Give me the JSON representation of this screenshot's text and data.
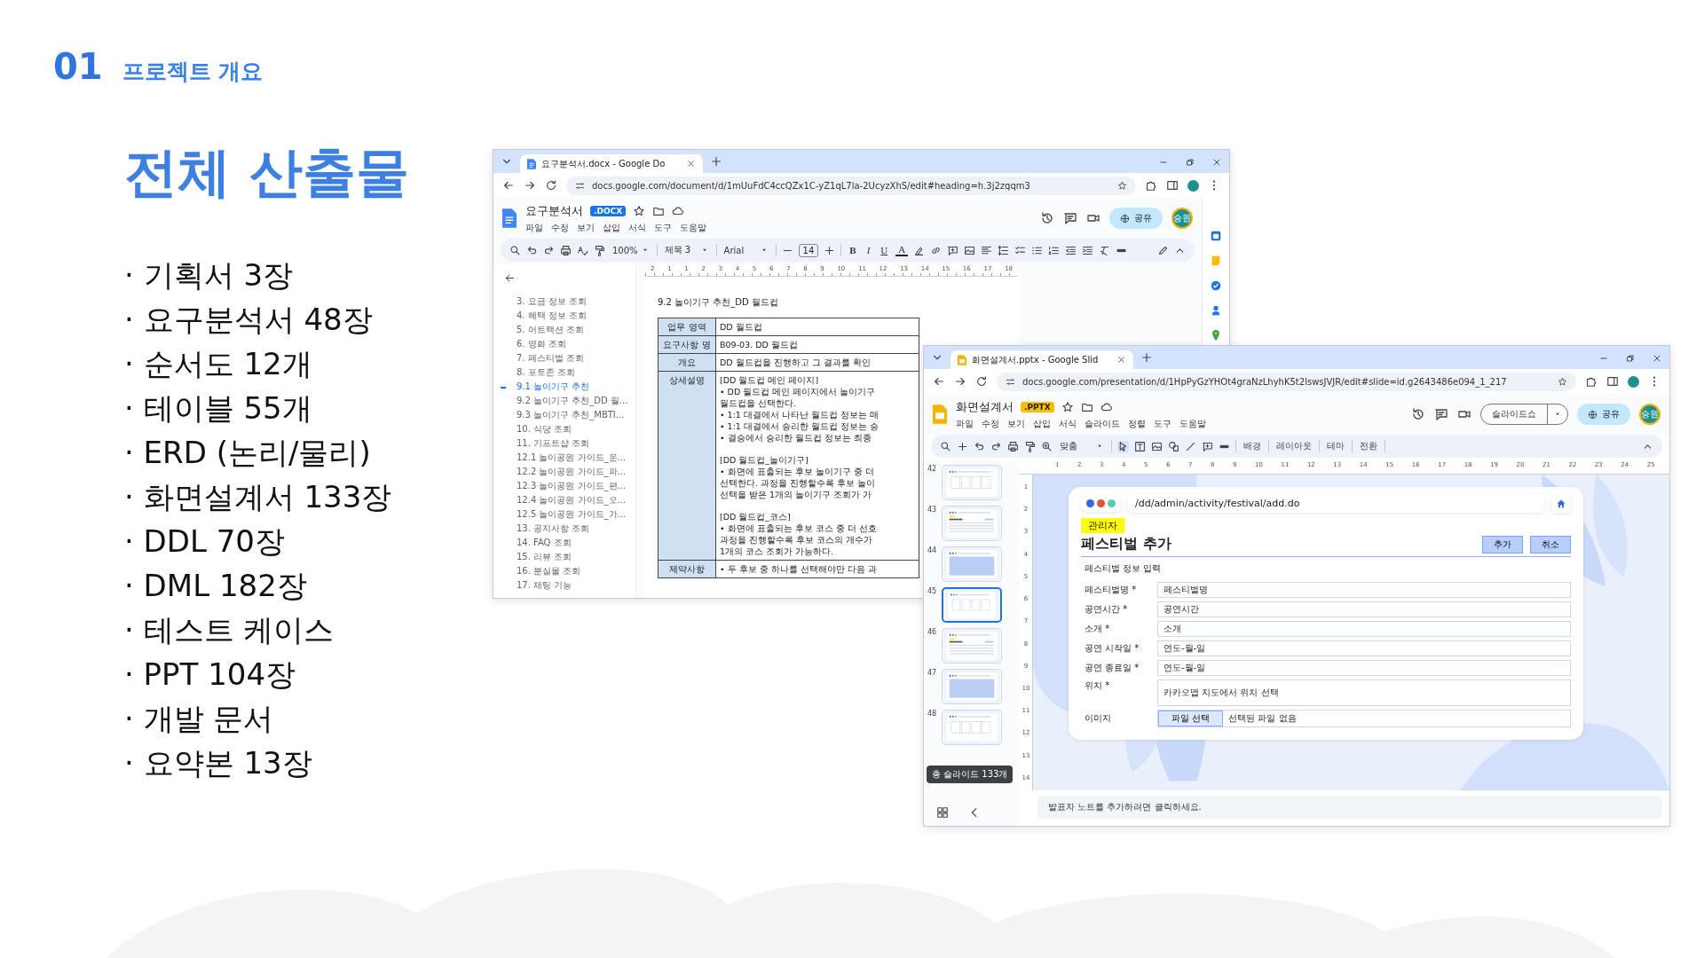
{
  "section": {
    "number": "01",
    "title": "프로젝트 개요"
  },
  "heading": "전체 산출물",
  "deliverables": [
    "· 기획서 3장",
    "· 요구분석서 48장",
    "· 순서도 12개",
    "· 테이블 55개",
    "· ERD (논리/물리)",
    "· 화면설계서 133장",
    "· DDL 70장",
    "· DML 182장",
    "· 테스트 케이스",
    "· PPT 104장",
    "· 개발 문서",
    "· 요약본 13장"
  ],
  "docs_window": {
    "tab_title": "요구분석서.docx - Google Do",
    "url": "docs.google.com/document/d/1mUuFdC4ccQZx1C-yZ1qL7la-2UcyzXhS/edit#heading=h.3j2zqqm3",
    "doc_title": "요구분석서",
    "badge": ".DOCX",
    "menu": [
      "파일",
      "수정",
      "보기",
      "삽입",
      "서식",
      "도구",
      "도움말"
    ],
    "share": "공유",
    "avatar": "승원",
    "toolbar": {
      "zoom": "100%",
      "style": "제목 3",
      "font": "Arial",
      "font_size": "14",
      "format": [
        "B",
        "I",
        "U",
        "A"
      ]
    },
    "ruler": [
      "2",
      "1",
      "1",
      "2",
      "3",
      "4",
      "5",
      "6",
      "7",
      "8",
      "9",
      "10",
      "11",
      "12",
      "13",
      "14",
      "15",
      "16",
      "17",
      "18"
    ],
    "outline": [
      {
        "text": "3. 요금 정보 조회",
        "selected": false
      },
      {
        "text": "4. 혜택 정보 조회",
        "selected": false
      },
      {
        "text": "5. 어트랙션 조회",
        "selected": false
      },
      {
        "text": "6. 영화 조회",
        "selected": false
      },
      {
        "text": "7. 페스티벌 조회",
        "selected": false
      },
      {
        "text": "8. 포토존 조회",
        "selected": false
      },
      {
        "text": "9.1 놀이기구 추천",
        "selected": true
      },
      {
        "text": "9.2 놀이기구 추천_DD 월...",
        "selected": false
      },
      {
        "text": "9.3 놀이기구 추천_MBTI...",
        "selected": false
      },
      {
        "text": "10. 식당 조회",
        "selected": false
      },
      {
        "text": "11. 기프트샵 조회",
        "selected": false
      },
      {
        "text": "12.1 놀이공원 가이드_운...",
        "selected": false
      },
      {
        "text": "12.2 놀이공원 가이드_파...",
        "selected": false
      },
      {
        "text": "12.3 놀이공원 가이드_편...",
        "selected": false
      },
      {
        "text": "12.4 놀이공원 가이드_오...",
        "selected": false
      },
      {
        "text": "12.5 놀이공원 가이드_가...",
        "selected": false
      },
      {
        "text": "13. 공지사항 조회",
        "selected": false
      },
      {
        "text": "14. FAQ 조회",
        "selected": false
      },
      {
        "text": "15. 리뷰 조회",
        "selected": false
      },
      {
        "text": "16. 분실물 조회",
        "selected": false
      },
      {
        "text": "17. 채팅 기능",
        "selected": false
      }
    ],
    "heading": "9.2 놀이기구 추천_DD 월드컵",
    "table": [
      {
        "label": "업무 영역",
        "paragraphs": [
          [
            "DD 월드컵"
          ]
        ]
      },
      {
        "label": "요구사항 명",
        "paragraphs": [
          [
            "B09-03. DD 월드컵"
          ]
        ]
      },
      {
        "label": "개요",
        "paragraphs": [
          [
            "DD 월드컵을 진행하고 그 결과를 확인"
          ]
        ]
      },
      {
        "label": "상세설명",
        "paragraphs": [
          [
            "[DD 월드컵 메인 페이지]",
            "• DD 월드컵 메인 페이지에서 놀이기구",
            "월드컵을 선택한다.",
            "• 1:1 대결에서 나타난 월드컵 정보는 매",
            "• 1:1 대결에서 승리한 월드컵 정보는 승",
            "• 결승에서 승리한 월드컵 정보는 최종"
          ],
          [
            "[DD 월드컵_놀이기구]",
            "• 화면에 표출되는 후보 놀이기구 중 더",
            "선택한다. 과정을 진행할수록 후보 놀이",
            "선택을 받은 1개의 놀이기구 조회가 가"
          ],
          [
            "[DD 월드컵_코스]",
            "• 화면에 표출되는 후보 코스 중 더 선호",
            "과정을 진행할수록 후보 코스의 개수가",
            "1개의 코스 조회가 가능하다."
          ]
        ]
      },
      {
        "label": "제약사항",
        "paragraphs": [
          [
            "• 두 후보 중 하나를 선택해야만 다음 과"
          ]
        ]
      }
    ]
  },
  "slides_window": {
    "tab_title": "화면설계서.pptx - Google Slid",
    "url": "docs.google.com/presentation/d/1HpPyGzYHOt4graNzLhyhK5t2lswsJVJR/edit#slide=id.g2643486e094_1_217",
    "title": "화면설계서",
    "badge": ".PPTX",
    "menu": [
      "파일",
      "수정",
      "보기",
      "삽입",
      "서식",
      "슬라이드",
      "정렬",
      "도구",
      "도움말"
    ],
    "slideshow": "슬라이드쇼",
    "share": "공유",
    "avatar": "승원",
    "toolbar": {
      "zoom": "맞춤",
      "tabs": [
        "배경",
        "레이아웃",
        "테마",
        "전환"
      ]
    },
    "ruler_h": [
      "1",
      "2",
      "3",
      "4",
      "5",
      "6",
      "7",
      "8",
      "9",
      "10",
      "11",
      "12",
      "13",
      "14",
      "15",
      "16",
      "17",
      "18",
      "19",
      "20",
      "21",
      "22",
      "23",
      "24",
      "25"
    ],
    "ruler_v": [
      "1",
      "2",
      "3",
      "4",
      "5",
      "6",
      "7",
      "8",
      "9",
      "10",
      "11",
      "12",
      "13",
      "14"
    ],
    "thumbnails": [
      {
        "number": "42",
        "selected": false
      },
      {
        "number": "43",
        "selected": false
      },
      {
        "number": "44",
        "selected": false
      },
      {
        "number": "45",
        "selected": true
      },
      {
        "number": "46",
        "selected": false
      },
      {
        "number": "47",
        "selected": false
      },
      {
        "number": "48",
        "selected": false
      }
    ],
    "slide_count": "총 슬라이드 133개",
    "slide": {
      "url": "/dd/admin/activity/festival/add.do",
      "tag": "관리자",
      "title": "페스티벌 추가",
      "buttons": [
        "추가",
        "취소"
      ],
      "section": "페스티벌 정보 입력",
      "fields": [
        {
          "kind": "text",
          "label": "페스티벌명 *",
          "value": "페스티벌명"
        },
        {
          "kind": "text",
          "label": "공연시간 *",
          "value": "공연시간"
        },
        {
          "kind": "text",
          "label": "소개 *",
          "value": "소개"
        },
        {
          "kind": "text",
          "label": "공연 시작일 *",
          "value": "연도-월-일"
        },
        {
          "kind": "text",
          "label": "공연 종료일 *",
          "value": "연도-월-일"
        },
        {
          "kind": "tall",
          "label": "위치 *",
          "value": "카카오맵 지도에서 위치 선택"
        },
        {
          "kind": "file",
          "label": "이미지",
          "button": "파일 선택",
          "value": "선택된 파일 없음"
        }
      ]
    },
    "notes": "발표자 노트를 추가하려면 클릭하세요."
  }
}
